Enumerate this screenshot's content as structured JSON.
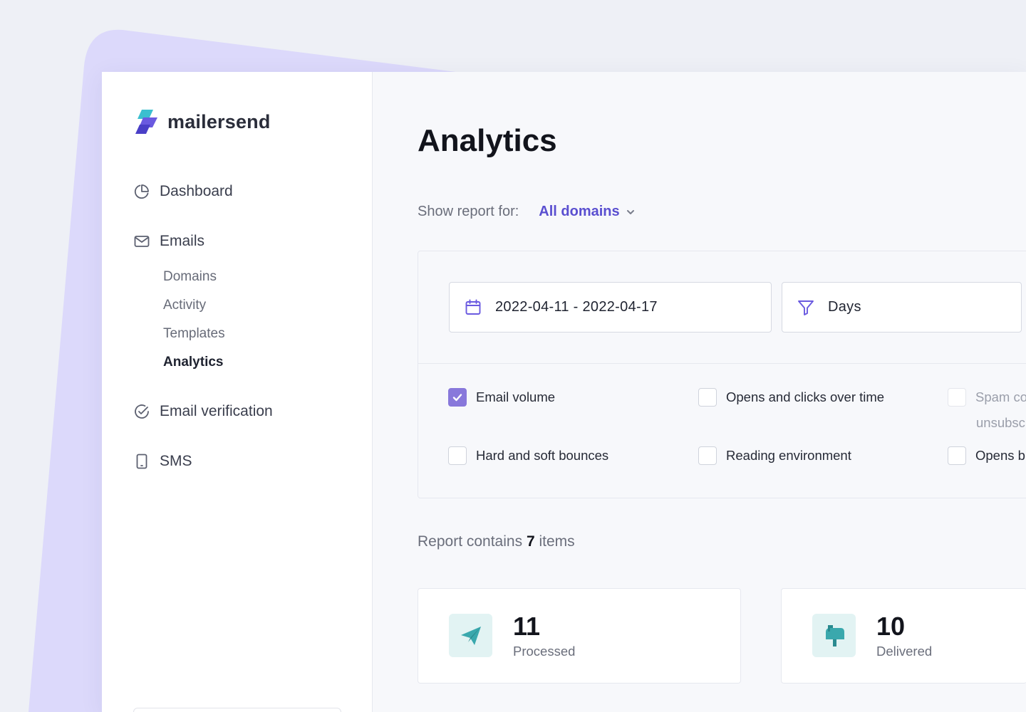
{
  "brand": {
    "name": "mailersend"
  },
  "sidebar": {
    "items": [
      {
        "label": "Dashboard",
        "icon": "pie-chart-icon"
      },
      {
        "label": "Emails",
        "icon": "mail-icon"
      },
      {
        "label": "Email verification",
        "icon": "check-circle-icon"
      },
      {
        "label": "SMS",
        "icon": "phone-icon"
      }
    ],
    "subitems": [
      {
        "label": "Domains",
        "active": false
      },
      {
        "label": "Activity",
        "active": false
      },
      {
        "label": "Templates",
        "active": false
      },
      {
        "label": "Analytics",
        "active": true
      }
    ]
  },
  "main": {
    "title": "Analytics",
    "report_for_label": "Show report for:",
    "domain_selected": "All domains",
    "date_range": "2022-04-11 - 2022-04-17",
    "group_by": "Days",
    "options": [
      {
        "label": "Email volume",
        "checked": true
      },
      {
        "label": "Opens and clicks over time",
        "checked": false
      },
      {
        "label": "Spam co",
        "line2": "unsubsc",
        "checked": false
      },
      {
        "label": "Hard and soft bounces",
        "checked": false
      },
      {
        "label": "Reading environment",
        "checked": false
      },
      {
        "label": "Opens b",
        "checked": false
      }
    ],
    "report_prefix": "Report contains",
    "report_count": "7",
    "report_suffix": "items",
    "stats": [
      {
        "value": "11",
        "label": "Processed",
        "icon": "paper-plane-icon"
      },
      {
        "value": "10",
        "label": "Delivered",
        "icon": "mailbox-icon"
      }
    ]
  },
  "colors": {
    "accent": "#5a4fd0",
    "checkbox": "#8878db",
    "teal": "#3aa8ad",
    "backdrop": "#dcd9fb"
  }
}
